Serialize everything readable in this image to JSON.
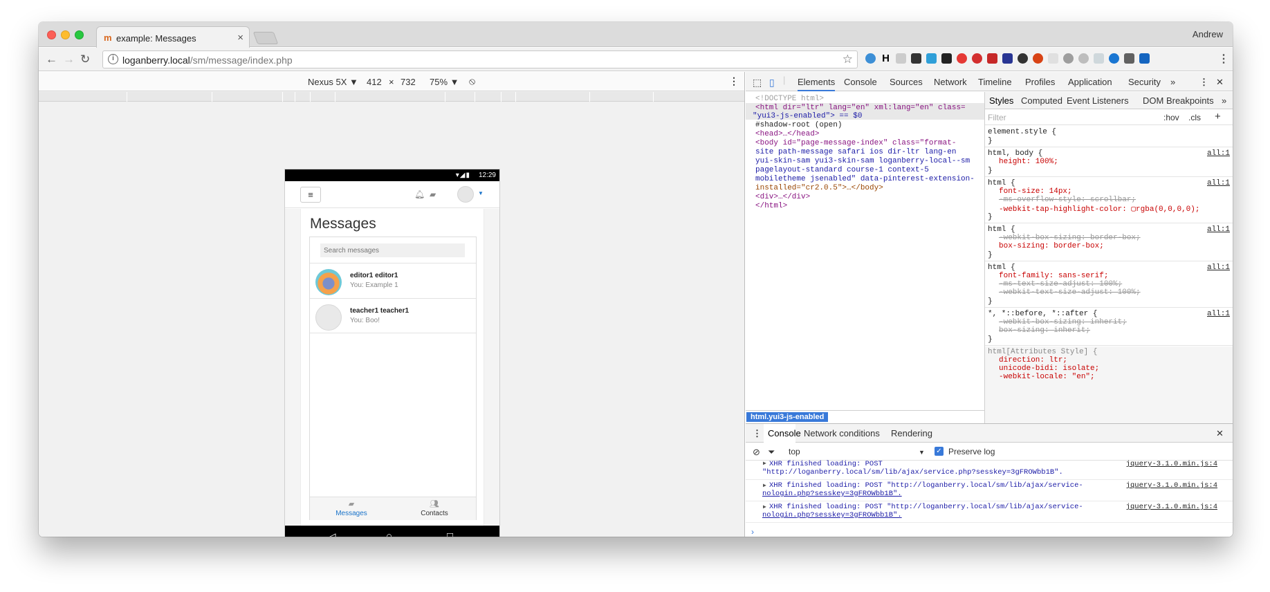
{
  "browser": {
    "tab_title": "example: Messages",
    "tab_close": "×",
    "favicon": "m",
    "profile_name": "Andrew",
    "url_host": "loganberry.local",
    "url_path": "/sm/message/index.php"
  },
  "device_toolbar": {
    "device": "Nexus 5X ▼",
    "width": "412",
    "times": "×",
    "height": "732",
    "zoom": "75% ▼"
  },
  "phone": {
    "status_icons": "▾◢▮",
    "time": "12:29",
    "page_title": "Messages",
    "search_placeholder": "Search messages",
    "conversations": [
      {
        "name": "editor1 editor1",
        "message": "You: Example 1"
      },
      {
        "name": "teacher1 teacher1",
        "message": "You: Boo!"
      }
    ],
    "nav": {
      "messages": "Messages",
      "contacts": "Contacts"
    }
  },
  "devtools": {
    "tabs": [
      "Elements",
      "Console",
      "Sources",
      "Network",
      "Timeline",
      "Profiles",
      "Application",
      "Security"
    ],
    "more": "»",
    "elements": {
      "doctype": "<!DOCTYPE html>",
      "html_open": "<html dir=\"ltr\" lang=\"en\" xml:lang=\"en\" class=",
      "html_class": "\"yui3-js-enabled\"> == $0",
      "shadow_root": "#shadow-root (open)",
      "head": "<head>…</head>",
      "body_1": "<body id=\"page-message-index\" class=\"format-",
      "body_2": "site  path-message safari ios dir-ltr lang-en",
      "body_3": "yui-skin-sam yui3-skin-sam loganberry-local--sm",
      "body_4": "pagelayout-standard course-1 context-5",
      "body_5": "mobiletheme  jsenabled\" data-pinterest-extension-",
      "body_6": "installed=\"cr2.0.5\">…</body>",
      "div": "<div>…</div>",
      "html_close": "</html>",
      "breadcrumb": "html.yui3-js-enabled"
    },
    "styles": {
      "tabs": [
        "Styles",
        "Computed",
        "Event Listeners",
        "DOM Breakpoints"
      ],
      "filter_placeholder": "Filter",
      "hov": ":hov",
      "cls": ".cls",
      "add": "+",
      "source": "all:1",
      "rules": [
        {
          "selector": "element.style {",
          "props": []
        },
        {
          "selector": "html, body {",
          "props": [
            "height: 100%;"
          ]
        },
        {
          "selector": "html {",
          "props": [
            "font-size: 14px;",
            "-ms-overflow-style: scrollbar;",
            "-webkit-tap-highlight-color: ▢rgba(0,0,0,0);"
          ]
        },
        {
          "selector": "html {",
          "props": [
            "-webkit-box-sizing: border-box;",
            "box-sizing: border-box;"
          ]
        },
        {
          "selector": "html {",
          "props": [
            "font-family: sans-serif;",
            "-ms-text-size-adjust: 100%;",
            "-webkit-text-size-adjust: 100%;"
          ]
        },
        {
          "selector": "*, *::before, *::after {",
          "props": [
            "-webkit-box-sizing: inherit;",
            "box-sizing: inherit;"
          ]
        },
        {
          "selector": "html[Attributes Style] {",
          "props": [
            "direction: ltr;",
            "unicode-bidi: isolate;",
            "-webkit-locale: \"en\";"
          ]
        }
      ],
      "close_brace": "}"
    },
    "drawer": {
      "tabs": [
        "Console",
        "Network conditions",
        "Rendering"
      ],
      "context": "top",
      "preserve_log": "Preserve log",
      "logs": [
        {
          "line1": "XHR finished loading: POST",
          "line2": "\"http://loganberry.local/sm/lib/ajax/service.php?sesskey=3gFROWbb1B\".",
          "source": "jquery-3.1.0.min.js:4"
        },
        {
          "line1": "XHR finished loading: POST \"http://loganberry.local/sm/lib/ajax/service-",
          "line2": "nologin.php?sesskey=3gFROWbb1B\".",
          "source": "jquery-3.1.0.min.js:4"
        },
        {
          "line1": "XHR finished loading: POST \"http://loganberry.local/sm/lib/ajax/service-",
          "line2": "nologin.php?sesskey=3gFROWbb1B\".",
          "source": "jquery-3.1.0.min.js:4"
        }
      ],
      "prompt": "›"
    }
  },
  "colors": {
    "accent": "#3879d9",
    "moodle_link": "#1a73c9"
  }
}
